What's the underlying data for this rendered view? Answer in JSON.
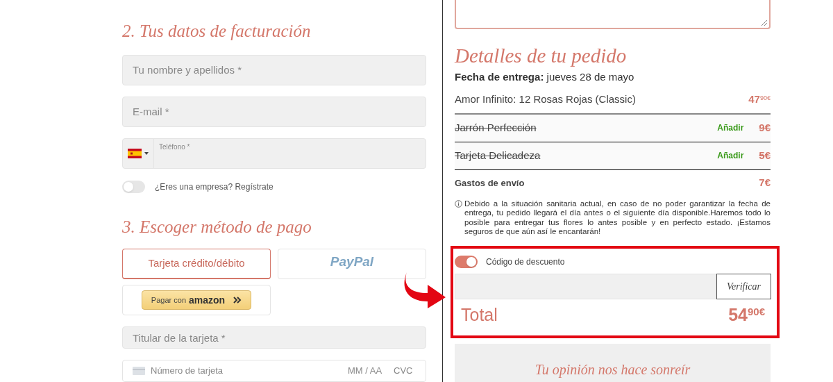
{
  "billing": {
    "heading": "2. Tus datos de facturación",
    "fields": [
      {
        "kind": "text",
        "placeholder": "Tu nombre y apellidos *"
      },
      {
        "kind": "text",
        "placeholder": "E-mail *"
      },
      {
        "kind": "phone",
        "placeholder": "Teléfono *"
      }
    ],
    "company_toggle": {
      "label": "¿Eres una empresa? Regístrate",
      "on": false
    }
  },
  "payment": {
    "heading": "3. Escoger método de pago",
    "methods": [
      {
        "kind": "card",
        "label": "Tarjeta crédito/débito",
        "selected": true
      },
      {
        "kind": "paypal",
        "label": "PayPal",
        "selected": false
      },
      {
        "kind": "amazon",
        "label": "Pagar con",
        "brand": "amazon",
        "selected": false
      }
    ],
    "cardholder": {
      "placeholder": "Titular de la tarjeta *"
    },
    "card_number": {
      "placeholder": "Número de tarjeta",
      "expiry_placeholder": "MM / AA",
      "cvc_placeholder": "CVC"
    }
  },
  "order": {
    "heading": "Detalles de tu pedido",
    "delivery": "**Fecha de entrega:** jueves 28 de mayo",
    "product": {
      "name": "Amor Infinito: 12 Rosas Rojas (Classic)",
      "price": "47$^{90€}$"
    },
    "extras": [
      {
        "name": "Jarrón Perfección",
        "action": "Añadir",
        "price": "9€",
        "added": false
      },
      {
        "name": "Tarjeta Delicadeza",
        "action": "Añadir",
        "price": "5€",
        "added": false
      }
    ],
    "shipping": {
      "label": "Gastos de envío",
      "price": "7€"
    },
    "notice": "Debido a la situación sanitaria actual, en caso de no poder garantizar la fecha de entrega, tu pedido llegará el día antes o el siguiente día disponible.Haremos todo lo posible para entregar tus flores lo antes posible y en perfecto estado. ¡Estamos seguros de que aún así le encantarán!",
    "discount": {
      "label": "Código de descuento",
      "on": true,
      "button": "Verificar"
    },
    "total": {
      "label": "Total",
      "price": "54$^{90€}$"
    },
    "feedback_title": "Tu opinión nos hace sonreír"
  }
}
